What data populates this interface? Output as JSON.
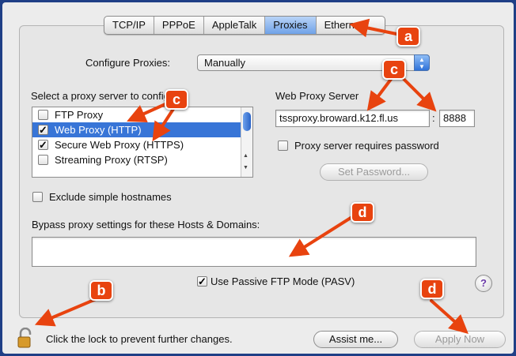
{
  "tabs": [
    {
      "label": "TCP/IP",
      "active": false
    },
    {
      "label": "PPPoE",
      "active": false
    },
    {
      "label": "AppleTalk",
      "active": false
    },
    {
      "label": "Proxies",
      "active": true
    },
    {
      "label": "Ethernet",
      "active": false
    }
  ],
  "configure": {
    "label": "Configure Proxies:",
    "value": "Manually"
  },
  "proxy_list": {
    "title": "Select a proxy server to configure:",
    "items": [
      {
        "label": "FTP Proxy",
        "checked": false,
        "selected": false,
        "check_glyph": ""
      },
      {
        "label": "Web Proxy (HTTP)",
        "checked": true,
        "selected": true,
        "check_glyph": "✓"
      },
      {
        "label": "Secure Web Proxy (HTTPS)",
        "checked": true,
        "selected": false,
        "check_glyph": "✓"
      },
      {
        "label": "Streaming Proxy (RTSP)",
        "checked": false,
        "selected": false,
        "check_glyph": ""
      }
    ]
  },
  "web_proxy": {
    "title": "Web Proxy Server",
    "host": "tssproxy.broward.k12.fl.us",
    "separator": ":",
    "port": "8888",
    "requires_password_label": "Proxy server requires password",
    "set_password_label": "Set Password..."
  },
  "exclude_simple_label": "Exclude simple hostnames",
  "bypass": {
    "label": "Bypass proxy settings for these Hosts & Domains:",
    "value": ""
  },
  "passive_ftp": {
    "label": "Use Passive FTP Mode (PASV)",
    "checked": true,
    "check_glyph": "✓"
  },
  "help_label": "?",
  "footer": {
    "lock_text": "Click the lock to prevent further changes.",
    "assist_label": "Assist me...",
    "apply_label": "Apply Now"
  },
  "annotations": {
    "a": "a",
    "b": "b",
    "c1": "c",
    "c2": "c",
    "d1": "d",
    "d2": "d",
    "color": "#e8430f"
  }
}
